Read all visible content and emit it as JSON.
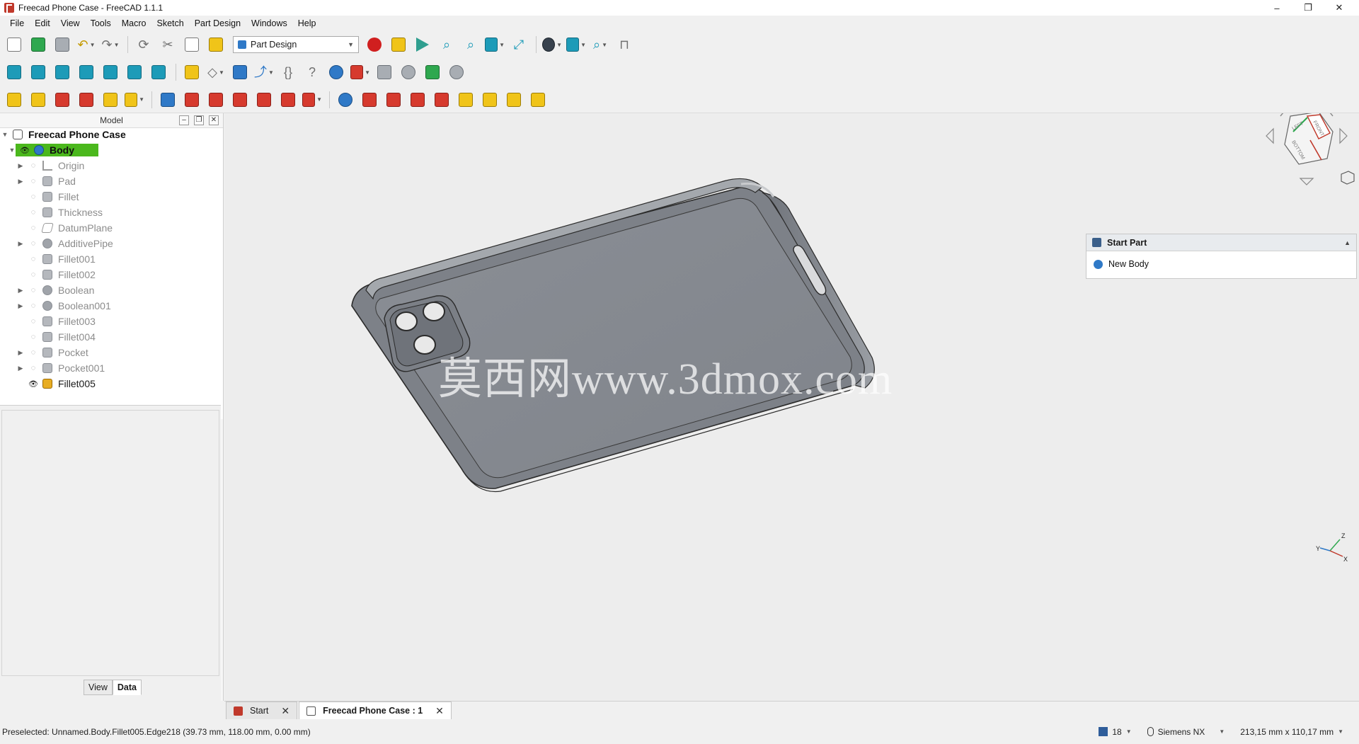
{
  "window": {
    "title": "Freecad Phone Case - FreeCAD 1.1.1",
    "minimize_label": "–",
    "maximize_label": "❐",
    "close_label": "✕"
  },
  "menubar": {
    "items": [
      {
        "label": "File"
      },
      {
        "label": "Edit"
      },
      {
        "label": "View"
      },
      {
        "label": "Tools"
      },
      {
        "label": "Macro"
      },
      {
        "label": "Sketch"
      },
      {
        "label": "Part Design"
      },
      {
        "label": "Windows"
      },
      {
        "label": "Help"
      }
    ]
  },
  "toolbar": {
    "workbench": "Part Design"
  },
  "model_panel": {
    "title": "Model",
    "tree": [
      {
        "label": "Freecad Phone Case",
        "icon": "document-icon",
        "level": 0,
        "expanded": true
      },
      {
        "label": "Body",
        "icon": "body-icon",
        "level": 1,
        "expanded": true,
        "visible": true,
        "active": true
      },
      {
        "label": "Origin",
        "icon": "origin-icon",
        "level": 2,
        "has_children": true
      },
      {
        "label": "Pad",
        "icon": "pad-icon",
        "level": 2,
        "has_children": true
      },
      {
        "label": "Fillet",
        "icon": "fillet-icon",
        "level": 2
      },
      {
        "label": "Thickness",
        "icon": "thickness-icon",
        "level": 2
      },
      {
        "label": "DatumPlane",
        "icon": "datum-plane-icon",
        "level": 2
      },
      {
        "label": "AdditivePipe",
        "icon": "additive-pipe-icon",
        "level": 2,
        "has_children": true
      },
      {
        "label": "Fillet001",
        "icon": "fillet-icon",
        "level": 2
      },
      {
        "label": "Fillet002",
        "icon": "fillet-icon",
        "level": 2
      },
      {
        "label": "Boolean",
        "icon": "boolean-icon",
        "level": 2,
        "has_children": true
      },
      {
        "label": "Boolean001",
        "icon": "boolean-icon",
        "level": 2,
        "has_children": true
      },
      {
        "label": "Fillet003",
        "icon": "fillet-icon",
        "level": 2
      },
      {
        "label": "Fillet004",
        "icon": "fillet-icon",
        "level": 2
      },
      {
        "label": "Pocket",
        "icon": "pocket-icon",
        "level": 2,
        "has_children": true
      },
      {
        "label": "Pocket001",
        "icon": "pocket-icon",
        "level": 2,
        "has_children": true
      },
      {
        "label": "Fillet005",
        "icon": "fillet-tip-icon",
        "level": 2,
        "visible": true
      }
    ],
    "tabs": {
      "view": "View",
      "data": "Data"
    }
  },
  "viewport": {
    "watermark": "莫西网www.3dmox.com",
    "navicube_faces": [
      "LEFT",
      "FRONT",
      "BOTTOM"
    ],
    "axis_labels": {
      "x": "X",
      "y": "Y",
      "z": "Z"
    }
  },
  "task_panel": {
    "title": "Start Part",
    "items": [
      {
        "label": "New Body"
      }
    ]
  },
  "doc_tabs": [
    {
      "label": "Start",
      "active": false
    },
    {
      "label": "Freecad Phone Case : 1",
      "active": true
    }
  ],
  "statusbar": {
    "message": "Preselected: Unnamed.Body.Fillet005.Edge218 (39.73 mm, 118.00 mm, 0.00 mm)",
    "precision": "18",
    "navigation_style": "Siemens NX",
    "dimensions": "213,15 mm x 110,17 mm"
  },
  "colors": {
    "body_highlight": "#4bb81d",
    "model_surface": "#8c9096",
    "viewport_bg": "#ededed"
  }
}
